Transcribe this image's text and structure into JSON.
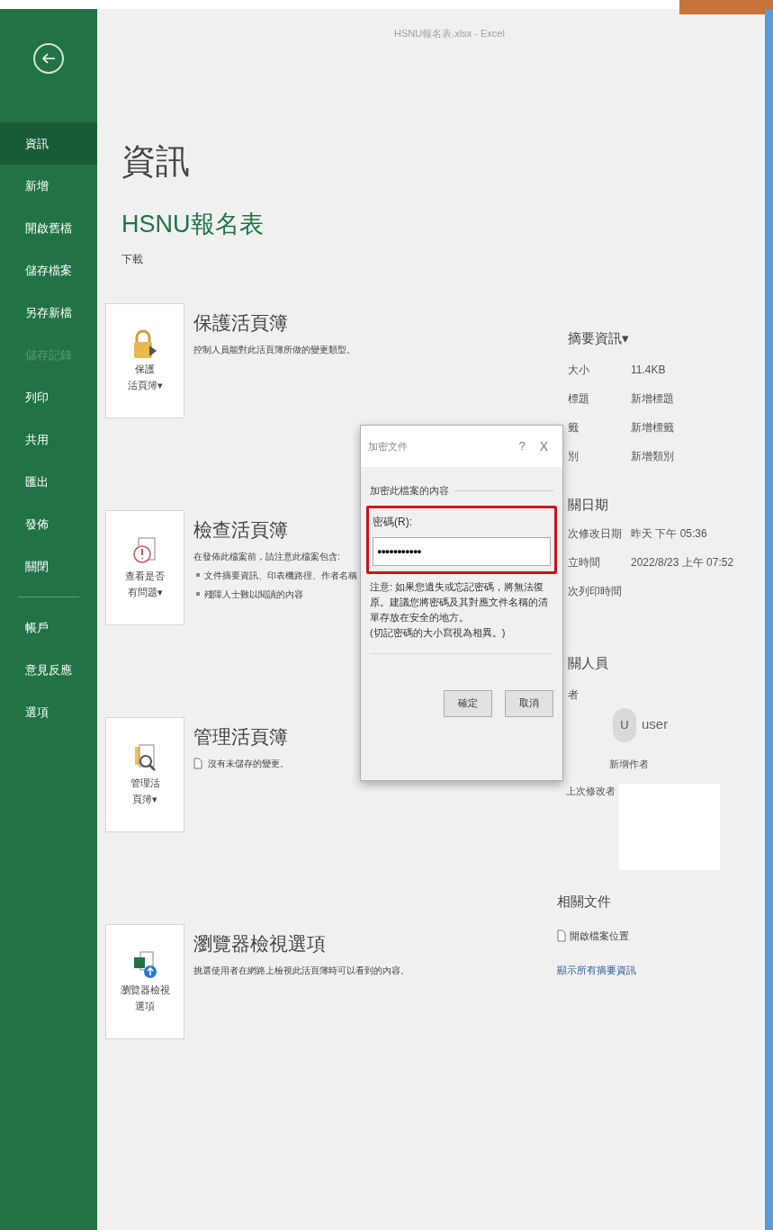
{
  "window": {
    "title": "HSNU報名表.xlsx - Excel"
  },
  "sidebar": {
    "items": [
      {
        "label": "資訊",
        "selected": true,
        "disabled": false
      },
      {
        "label": "新增",
        "selected": false,
        "disabled": false
      },
      {
        "label": "開啟舊檔",
        "selected": false,
        "disabled": false
      },
      {
        "label": "儲存檔案",
        "selected": false,
        "disabled": false
      },
      {
        "label": "另存新檔",
        "selected": false,
        "disabled": false
      },
      {
        "label": "儲存記錄",
        "selected": false,
        "disabled": true
      },
      {
        "label": "列印",
        "selected": false,
        "disabled": false
      },
      {
        "label": "共用",
        "selected": false,
        "disabled": false
      },
      {
        "label": "匯出",
        "selected": false,
        "disabled": false
      },
      {
        "label": "發佈",
        "selected": false,
        "disabled": false
      },
      {
        "label": "關閉",
        "selected": false,
        "disabled": false
      }
    ],
    "bottom_items": [
      {
        "label": "帳戶",
        "selected": false,
        "disabled": false
      },
      {
        "label": "意見反應",
        "selected": false,
        "disabled": false
      },
      {
        "label": "選項",
        "selected": false,
        "disabled": false
      }
    ]
  },
  "heading": "資訊",
  "file_name": "HSNU報名表",
  "file_path": "下載",
  "sections": [
    {
      "kind": "lock",
      "button": [
        "保護",
        "活頁簿▾"
      ],
      "title": "保護活頁簿",
      "description": "控制人員能對此活頁簿所做的變更類型。"
    },
    {
      "kind": "inspect",
      "button": [
        "查看是否",
        "有問題▾"
      ],
      "title": "檢查活頁簿",
      "description": "在發佈此檔案前，請注意此檔案包含:",
      "bullets": [
        "文件摘要資訊、印表機路徑、作者名稱",
        "殘障人士難以閱讀的內容"
      ]
    },
    {
      "kind": "manage",
      "button": [
        "管理活",
        "頁簿▾"
      ],
      "title": "管理活頁簿",
      "description": "沒有未儲存的變更。"
    },
    {
      "kind": "browser",
      "button": [
        "瀏覽器檢視",
        "選項"
      ],
      "title": "瀏覽器檢視選項",
      "description": "挑選使用者在網路上檢視此活頁簿時可以看到的內容。"
    }
  ],
  "properties": {
    "title": "摘要資訊▾",
    "rows": [
      {
        "label": "大小",
        "value": "11.4KB"
      },
      {
        "label": "標題",
        "value": "新增標題"
      },
      {
        "label": "籤",
        "value": "新增標籤"
      },
      {
        "label": "別",
        "value": "新增類別"
      }
    ],
    "dates_title": "關日期",
    "date_rows": [
      {
        "label": "次修改日期",
        "value": "昨天 下午 05:36"
      },
      {
        "label": "立時間",
        "value": "2022/8/23 上午 07:52"
      },
      {
        "label": "次列印時間"
      }
    ],
    "people_title": "關人員",
    "author_label": "者",
    "author_initial": "U",
    "author_name": "user",
    "add_author": "新增作者",
    "last_modified_label": "上次修改者",
    "docs_title": "相關文件",
    "open_location": "開啟檔案位置",
    "show_all": "顯示所有摘要資訊"
  },
  "dialog": {
    "title": "加密文件",
    "help": "?",
    "close": "X",
    "group": "加密此檔案的內容",
    "field_label": "密碼(R):",
    "value": "●●●●●●●●●●●",
    "highlighted": true,
    "note": "注意: 如果您遺失或忘記密碼，將無法復原。建議您將密碼及其對應文件名稱的清單存放在安全的地方。",
    "note2": "(切記密碼的大小寫視為相異。)",
    "buttons": [
      "確定",
      "取消"
    ]
  }
}
